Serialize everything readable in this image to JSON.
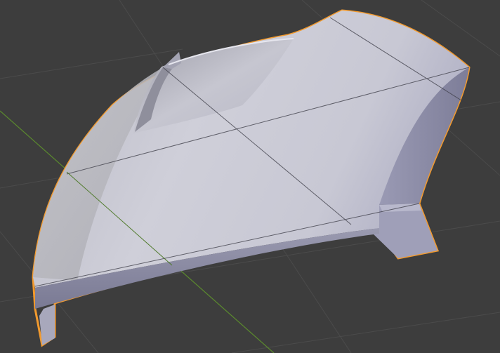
{
  "viewport": {
    "background_color": "#3d3d3d",
    "grid_line_color": "#4a4a4a",
    "x_axis_color": "#5b8a2e",
    "selection_outline_color": "#f29a2e"
  },
  "mesh": {
    "object": "car-body-panel",
    "selected": true,
    "face_color": "#c9c9d6",
    "shadow_color": "#8e8ea6"
  }
}
